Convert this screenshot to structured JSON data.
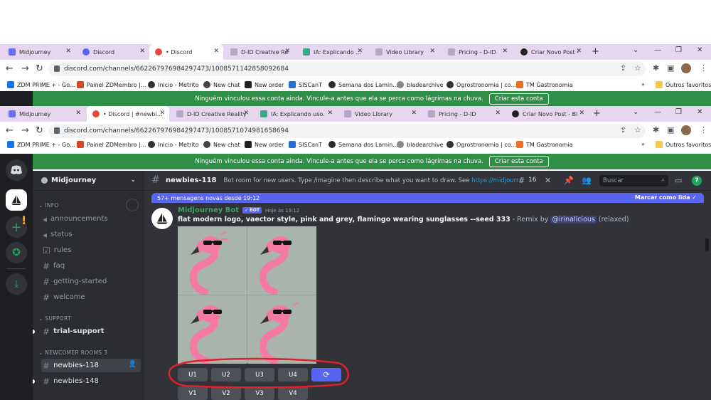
{
  "browser_back": {
    "tabs": [
      {
        "label": "Midjourney",
        "color": "#6a6cff"
      },
      {
        "label": "Discord",
        "color": "#5865f2"
      },
      {
        "label": "• Discord",
        "color": "#e84a3d"
      },
      {
        "label": "D-ID Creative Re",
        "color": "#8a7aa0"
      },
      {
        "label": "IA: Explicando us",
        "color": "#3aaa86"
      },
      {
        "label": "Video Library",
        "color": "#8a7aa0"
      },
      {
        "label": "Pricing - D-ID",
        "color": "#8a7aa0"
      },
      {
        "label": "Criar Novo Post -",
        "color": "#222222"
      }
    ],
    "url": "discord.com/channels/662267976984297473/1008571142858092684"
  },
  "browser_front": {
    "tabs": [
      {
        "label": "Midjourney",
        "color": "#6a6cff"
      },
      {
        "label": "• Discord | #newbies-",
        "color": "#e84a3d"
      },
      {
        "label": "D-ID Creative Reality",
        "color": "#8a7aa0"
      },
      {
        "label": "IA: Explicando uso.",
        "color": "#3aaa86"
      },
      {
        "label": "Video Library",
        "color": "#8a7aa0"
      },
      {
        "label": "Pricing - D-ID",
        "color": "#8a7aa0"
      },
      {
        "label": "Criar Novo Post - Bl",
        "color": "#222222"
      }
    ],
    "url": "discord.com/channels/662267976984297473/1008571074981658694"
  },
  "bookmarks": [
    {
      "label": "ZDM PRIME + - Go...",
      "color": "#1a73e8"
    },
    {
      "label": "Painel ZDMembro |...",
      "color": "#d04a2a"
    },
    {
      "label": "Inicio - Metrito",
      "color": "#333333"
    },
    {
      "label": "New chat",
      "color": "#444444"
    },
    {
      "label": "New order",
      "color": "#222222"
    },
    {
      "label": "SISCanT",
      "color": "#2a6fd0"
    },
    {
      "label": "Semana dos Lamin...",
      "color": "#2a2a2a"
    },
    {
      "label": "bladearchive",
      "color": "#666666"
    },
    {
      "label": "Ogrostronomia | co...",
      "color": "#333333"
    },
    {
      "label": "TM Gastronomia",
      "color": "#e8712a"
    }
  ],
  "bookmarks_more": "»",
  "bookmarks_other": "Outros favoritos",
  "notice": {
    "text": "Ninguém vinculou essa conta ainda. Vincule-a antes que ela se perca como lágrimas na chuva.",
    "button": "Criar esta conta"
  },
  "server": {
    "name": "Midjourney"
  },
  "categories": {
    "info": "INFO",
    "support": "SUPPORT",
    "newcomer": "NEWCOMER ROOMS 3"
  },
  "channels": {
    "info": [
      "announcements",
      "status",
      "rules",
      "faq",
      "getting-started",
      "welcome"
    ],
    "support": [
      "trial-support"
    ],
    "newcomer": [
      "newbies-118",
      "newbies-148"
    ]
  },
  "channel_header": {
    "name": "newbies-118",
    "topic": "Bot room for new users. Type /imagine then describe what you want to draw. See",
    "topic_link": "https://midjourney.git...",
    "thread_count": "16",
    "search_placeholder": "Buscar"
  },
  "new_messages": {
    "text": "57+ mensagens novas desde 19:12",
    "mark_read": "Marcar como lida"
  },
  "message": {
    "author": "Midjourney Bot",
    "bot_tag": "✓ BOT",
    "time": "Hoje às 19:12",
    "prompt": "flat modern logo, vaector style, pink and grey, flamingo wearing sunglasses --seed 333",
    "suffix": " - Remix by ",
    "mention": "@irinalicious",
    "mode": " (relaxed)"
  },
  "buttons": {
    "upscale": [
      "U1",
      "U2",
      "U3",
      "U4"
    ],
    "variation": [
      "V1",
      "V2",
      "V3",
      "V4"
    ]
  },
  "colors": {
    "flamingo_pink": "#f47aa3",
    "annotation_red": "#e0202a",
    "blurple": "#5865f2"
  }
}
